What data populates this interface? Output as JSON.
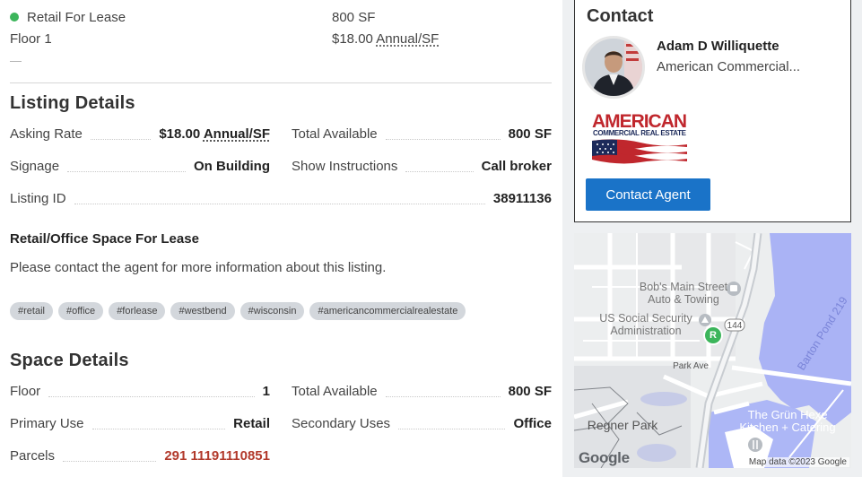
{
  "summary": {
    "listing_type": "Retail For Lease",
    "floor": "Floor 1",
    "size": "800 SF",
    "rate_amount": "$18.00",
    "rate_unit": "Annual/SF",
    "dash": "—"
  },
  "listing_details": {
    "title": "Listing Details",
    "asking_rate_label": "Asking Rate",
    "asking_rate_amount": "$18.00",
    "asking_rate_unit": "Annual/SF",
    "total_available_label": "Total Available",
    "total_available_value": "800 SF",
    "signage_label": "Signage",
    "signage_value": "On Building",
    "show_instructions_label": "Show Instructions",
    "show_instructions_value": "Call broker",
    "listing_id_label": "Listing ID",
    "listing_id_value": "38911136",
    "subheading": "Retail/Office Space For Lease",
    "description": "Please contact the agent for more information about this listing.",
    "tags": [
      "#retail",
      "#office",
      "#forlease",
      "#westbend",
      "#wisconsin",
      "#americancommercialrealestate"
    ]
  },
  "space_details": {
    "title": "Space Details",
    "floor_label": "Floor",
    "floor_value": "1",
    "total_available_label": "Total Available",
    "total_available_value": "800 SF",
    "primary_use_label": "Primary Use",
    "primary_use_value": "Retail",
    "secondary_uses_label": "Secondary Uses",
    "secondary_uses_value": "Office",
    "parcels_label": "Parcels",
    "parcels_value": "291 11191110851"
  },
  "contact": {
    "title": "Contact",
    "agent_name": "Adam D Williquette",
    "agent_company": "American Commercial...",
    "logo_line1": "AMERICAN",
    "logo_line2": "COMMERCIAL REAL ESTATE",
    "button_label": "Contact Agent"
  },
  "map": {
    "labels": {
      "bobs": "Bob's Main Street",
      "bobs2": "Auto & Towing",
      "ssa": "US Social Security",
      "ssa2": "Administration",
      "park_ave": "Park Ave",
      "route": "144",
      "regner": "Regner Park",
      "grun1": "The Grün Hexe",
      "grun2": "Kitchen + Catering",
      "barton": "Barton Pond 219",
      "marker": "R"
    },
    "google": "Google",
    "attribution": "Map data ©2023 Google"
  },
  "colors": {
    "status_green": "#3cb55b",
    "link_red": "#b23a2c",
    "button_blue": "#1a73c8",
    "water": "#aab3f5"
  }
}
